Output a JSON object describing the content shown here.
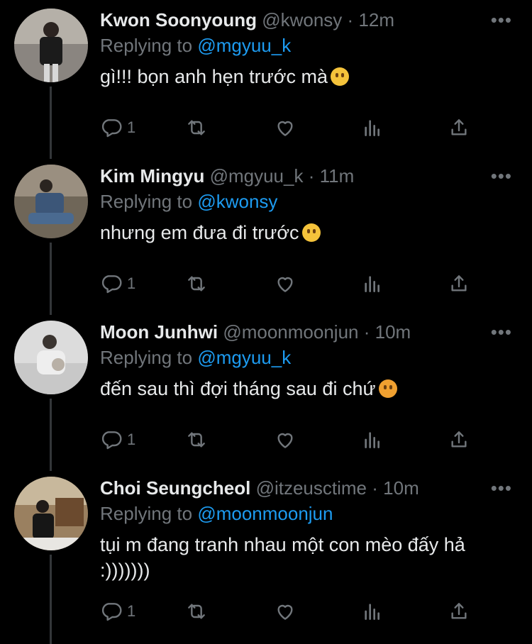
{
  "tweets": [
    {
      "name": "Kwon Soonyoung",
      "handle": "@kwonsy",
      "dot": "·",
      "time": "12m",
      "reply_prefix": "Replying to",
      "mention": "@mgyuu_k",
      "text": "gì!!! bọn anh hẹn trước mà",
      "emoji": "raised-eyebrow-emoji",
      "reply_count": "1"
    },
    {
      "name": "Kim Mingyu",
      "handle": "@mgyuu_k",
      "dot": "·",
      "time": "11m",
      "reply_prefix": "Replying to",
      "mention": "@kwonsy",
      "text": "nhưng em đưa đi trước",
      "emoji": "kissing-emoji",
      "reply_count": "1"
    },
    {
      "name": "Moon Junhwi",
      "handle": "@moonmoonjun",
      "dot": "·",
      "time": "10m",
      "reply_prefix": "Replying to",
      "mention": "@mgyuu_k",
      "text": "đến sau thì đợi tháng sau đi chứ",
      "emoji": "angry-emoji",
      "reply_count": "1"
    },
    {
      "name": "Choi Seungcheol",
      "handle": "@itzeusctime",
      "dot": "·",
      "time": "10m",
      "reply_prefix": "Replying to",
      "mention": "@moonmoonjun",
      "text": "tụi m đang tranh nhau một con mèo đấy hả :)))))))",
      "emoji": "",
      "reply_count": "1"
    }
  ],
  "more_label": "•••",
  "icons": [
    "reply-icon",
    "retweet-icon",
    "like-icon",
    "analytics-icon",
    "share-icon"
  ],
  "colors": {
    "background": "#000000",
    "text": "#e7e9ea",
    "muted": "#71767b",
    "mention": "#1d9bf0"
  }
}
